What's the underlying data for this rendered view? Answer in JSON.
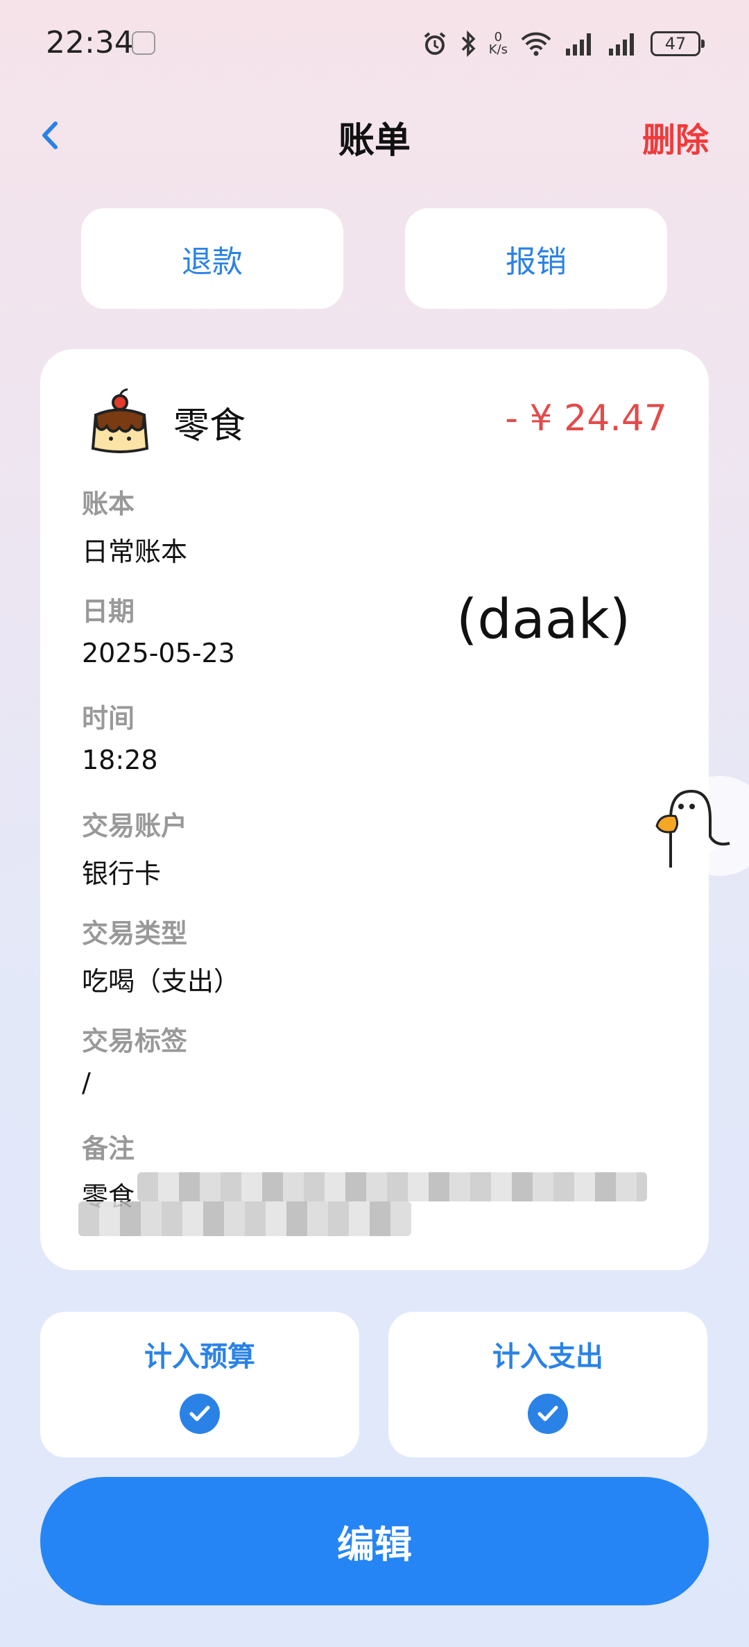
{
  "status_bar": {
    "time": "22:34",
    "net_speed_value": "0",
    "net_speed_unit": "K/s",
    "battery": "47"
  },
  "nav": {
    "title": "账单",
    "delete_label": "删除"
  },
  "actions": {
    "refund_label": "退款",
    "reimburse_label": "报销"
  },
  "bill": {
    "category": "零食",
    "category_icon": "pudding-icon",
    "amount": "- ¥ 24.47",
    "amount_color": "#e34b4b",
    "fields": [
      {
        "label": "账本",
        "value": "日常账本"
      },
      {
        "label": "日期",
        "value": "2025-05-23"
      },
      {
        "label": "时间",
        "value": "18:28"
      },
      {
        "label": "交易账户",
        "value": "银行卡"
      },
      {
        "label": "交易类型",
        "value": "吃喝（支出）"
      },
      {
        "label": "交易标签",
        "value": "/"
      },
      {
        "label": "备注",
        "value": "零食"
      }
    ],
    "overlay_text": "(daak)"
  },
  "toggles": {
    "budget_label": "计入预算",
    "budget_checked": true,
    "expense_label": "计入支出",
    "expense_checked": true
  },
  "edit_label": "编辑",
  "colors": {
    "accent": "#2585f5",
    "danger": "#ef3b3b"
  }
}
